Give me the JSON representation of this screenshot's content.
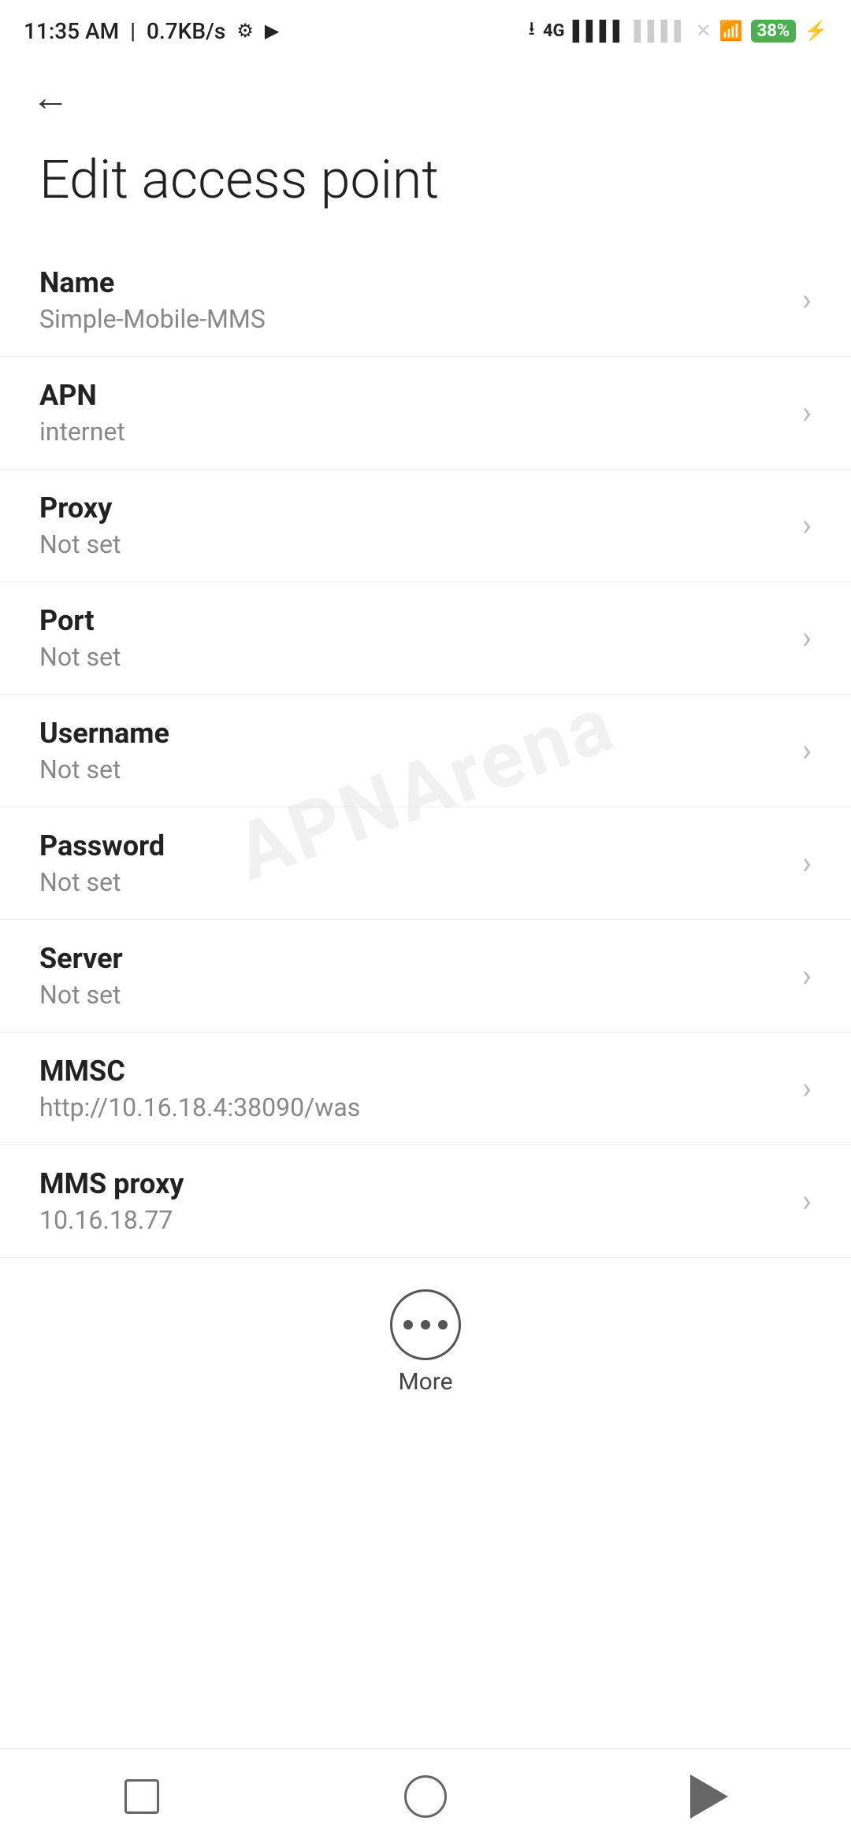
{
  "statusBar": {
    "time": "11:35 AM",
    "speed": "0.7KB/s",
    "battery": "38"
  },
  "header": {
    "backLabel": "←",
    "title": "Edit access point"
  },
  "settings": [
    {
      "label": "Name",
      "value": "Simple-Mobile-MMS"
    },
    {
      "label": "APN",
      "value": "internet"
    },
    {
      "label": "Proxy",
      "value": "Not set"
    },
    {
      "label": "Port",
      "value": "Not set"
    },
    {
      "label": "Username",
      "value": "Not set"
    },
    {
      "label": "Password",
      "value": "Not set"
    },
    {
      "label": "Server",
      "value": "Not set"
    },
    {
      "label": "MMSC",
      "value": "http://10.16.18.4:38090/was"
    },
    {
      "label": "MMS proxy",
      "value": "10.16.18.77"
    }
  ],
  "more": {
    "label": "More"
  },
  "watermark": "APNArena",
  "navbar": {
    "square": "recent",
    "circle": "home",
    "triangle": "back"
  }
}
